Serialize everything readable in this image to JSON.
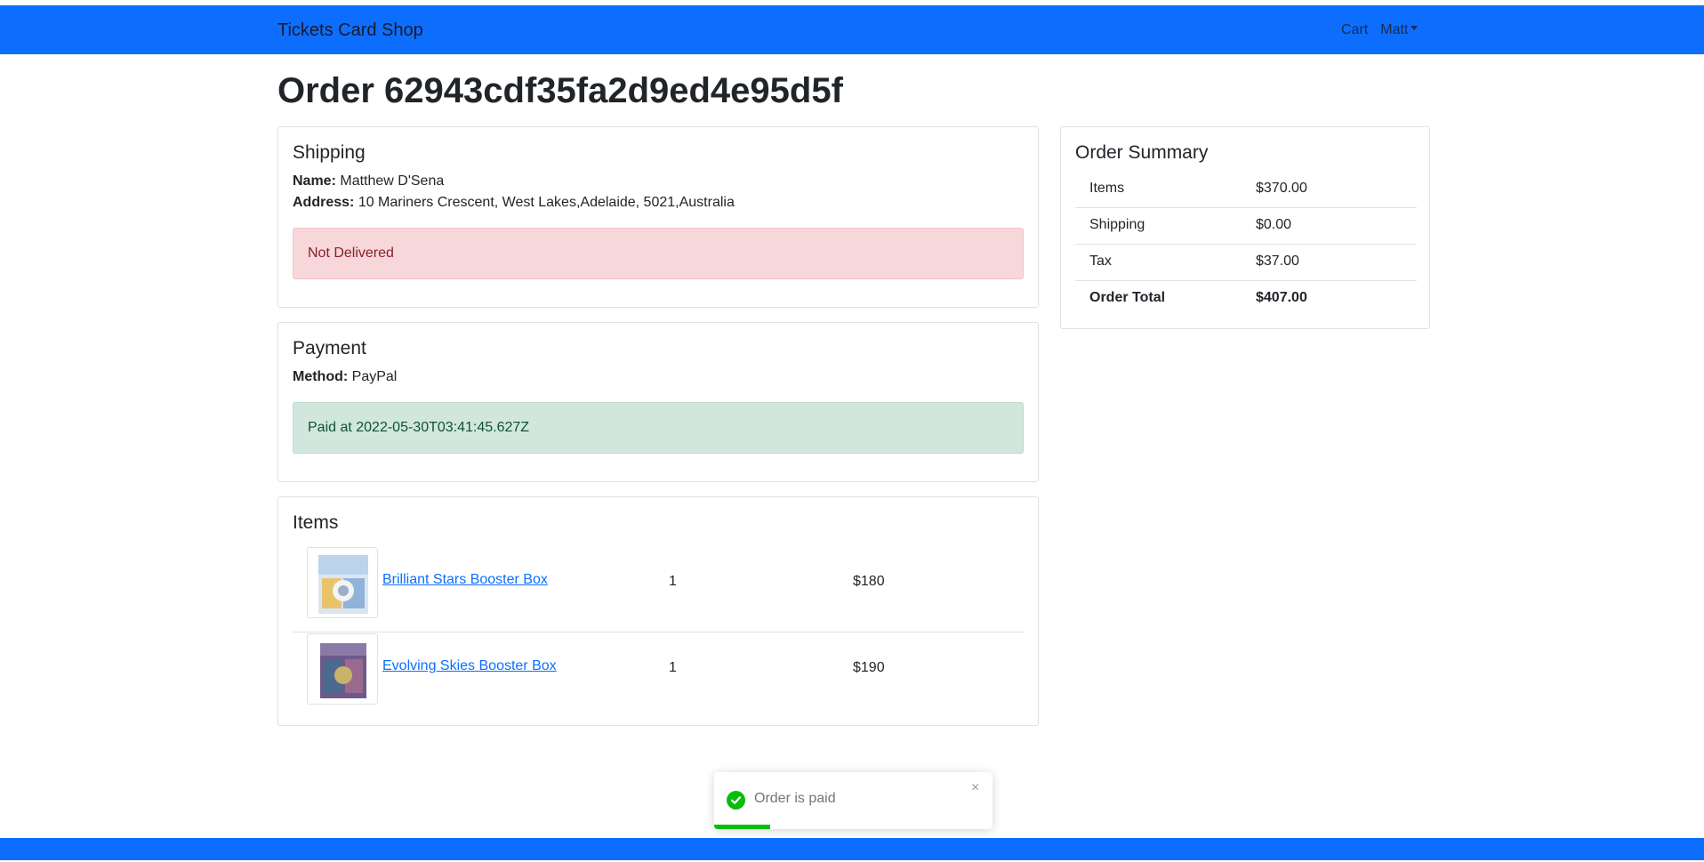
{
  "navbar": {
    "brand": "Tickets Card Shop",
    "cart_label": "Cart",
    "user_label": "Matt"
  },
  "order": {
    "title": "Order 62943cdf35fa2d9ed4e95d5f"
  },
  "shipping": {
    "heading": "Shipping",
    "name_label": "Name:",
    "name_value": "Matthew D'Sena",
    "address_label": "Address:",
    "address_value": "10 Mariners Crescent, West Lakes,Adelaide, 5021,Australia",
    "status": "Not Delivered"
  },
  "payment": {
    "heading": "Payment",
    "method_label": "Method:",
    "method_value": "PayPal",
    "status": "Paid at 2022-05-30T03:41:45.627Z"
  },
  "items": {
    "heading": "Items",
    "list": [
      {
        "name": "Brilliant Stars Booster Box",
        "qty": "1",
        "price": "$180"
      },
      {
        "name": "Evolving Skies Booster Box",
        "qty": "1",
        "price": "$190"
      }
    ]
  },
  "summary": {
    "heading": "Order Summary",
    "rows": [
      {
        "label": "Items",
        "value": "$370.00"
      },
      {
        "label": "Shipping",
        "value": "$0.00"
      },
      {
        "label": "Tax",
        "value": "$37.00"
      },
      {
        "label": "Order Total",
        "value": "$407.00"
      }
    ]
  },
  "toast": {
    "message": "Order is paid",
    "close": "×",
    "progress": 0.2
  },
  "colors": {
    "primary": "#0d6efd",
    "danger_bg": "#f8d7da",
    "success_bg": "#d1e7dd",
    "toast_green": "#07bc0c"
  }
}
